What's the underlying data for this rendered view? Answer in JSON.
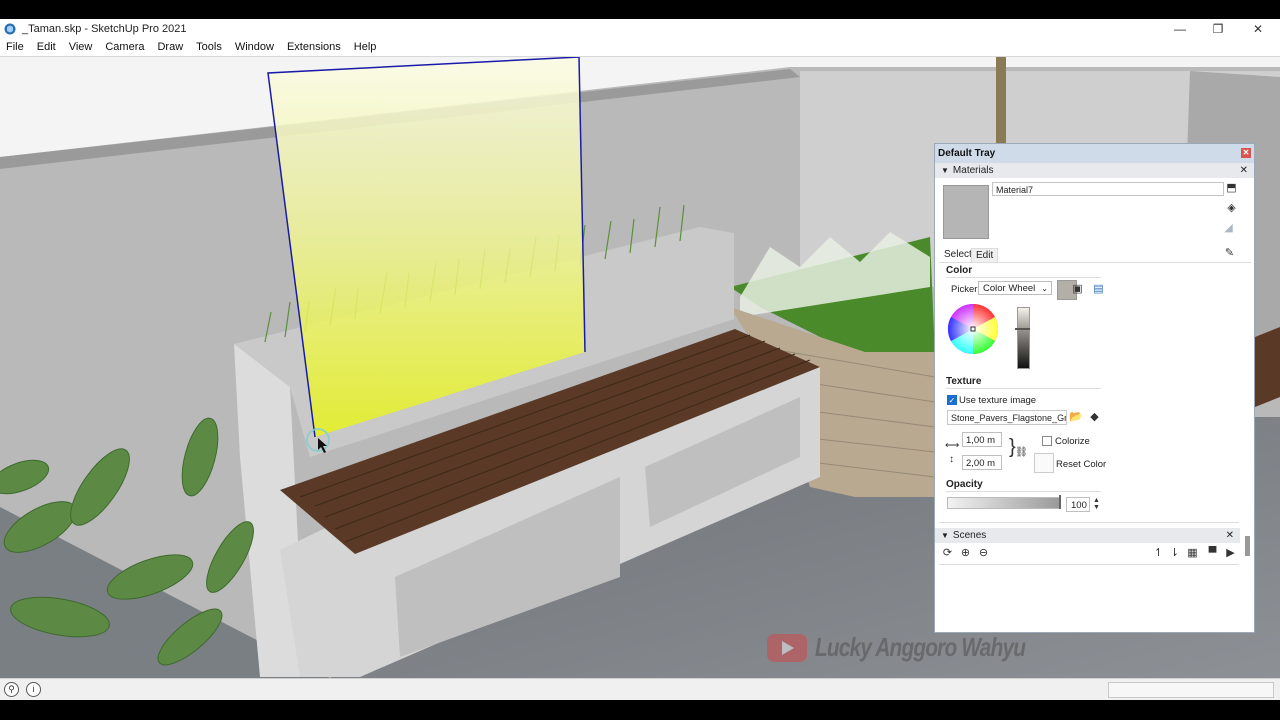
{
  "window": {
    "title": "_Taman.skp - SketchUp Pro 2021",
    "controls": {
      "minimize": "—",
      "restore": "❐",
      "close": "✕"
    }
  },
  "menu": [
    "File",
    "Edit",
    "View",
    "Camera",
    "Draw",
    "Tools",
    "Window",
    "Extensions",
    "Help"
  ],
  "tray": {
    "title": "Default Tray",
    "close": "✕",
    "materials": {
      "header": "Materials",
      "name_value": "Material7",
      "tabs": [
        "Select",
        "Edit"
      ],
      "active_tab": "Edit",
      "color_label": "Color",
      "picker_label": "Picker:",
      "picker_value": "Color Wheel",
      "texture_label": "Texture",
      "use_texture_label": "Use texture image",
      "use_texture_checked": true,
      "texture_file": "Stone_Pavers_Flagstone_Gray",
      "width_value": "1,00 m",
      "height_value": "2,00 m",
      "colorize_label": "Colorize",
      "reset_color_label": "Reset Color",
      "opacity_label": "Opacity",
      "opacity_value": "100"
    },
    "scenes": {
      "header": "Scenes"
    }
  },
  "watermark": {
    "text": "Lucky Anggoro Wahyu"
  },
  "colors": {
    "tray_title_bg": "#cfdbe8",
    "yellow_face": "#e8f23a",
    "wood": "#5a3a26",
    "grass": "#4a8a2a"
  }
}
